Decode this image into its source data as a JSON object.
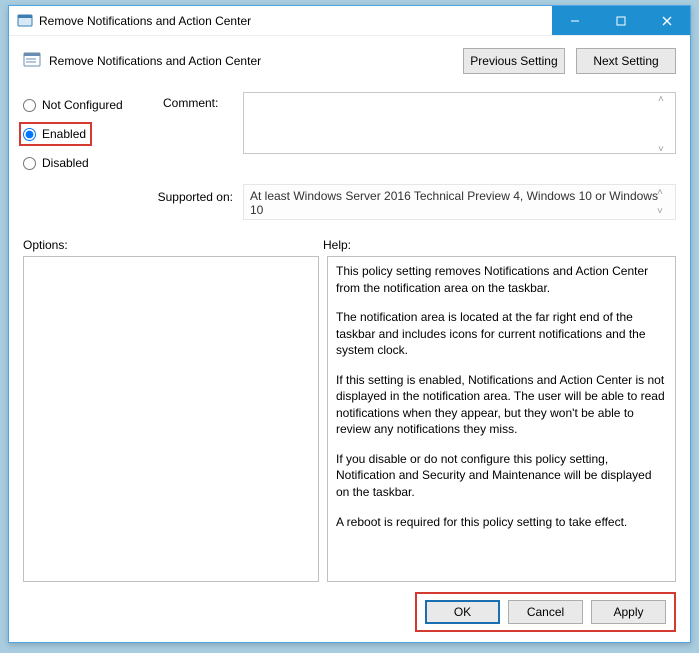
{
  "window": {
    "title": "Remove Notifications and Action Center"
  },
  "header": {
    "policy_title": "Remove Notifications and Action Center",
    "previous_btn": "Previous Setting",
    "next_btn": "Next Setting"
  },
  "radios": {
    "not_configured": "Not Configured",
    "enabled": "Enabled",
    "disabled": "Disabled",
    "selected": "enabled"
  },
  "labels": {
    "comment": "Comment:",
    "supported_on": "Supported on:",
    "options": "Options:",
    "help": "Help:"
  },
  "fields": {
    "comment_value": "",
    "supported_text": "At least Windows Server 2016 Technical Preview 4, Windows 10 or Windows 10"
  },
  "help": {
    "p1": "This policy setting removes Notifications and Action Center from the notification area on the taskbar.",
    "p2": "The notification area is located at the far right end of the taskbar and includes icons for current notifications and the system clock.",
    "p3": "If this setting is enabled, Notifications and Action Center is not displayed in the notification area. The user will be able to read notifications when they appear, but they won't be able to review any notifications they miss.",
    "p4": "If you disable or do not configure this policy setting, Notification and Security and Maintenance will be displayed on the taskbar.",
    "p5": "A reboot is required for this policy setting to take effect."
  },
  "footer": {
    "ok": "OK",
    "cancel": "Cancel",
    "apply": "Apply"
  }
}
